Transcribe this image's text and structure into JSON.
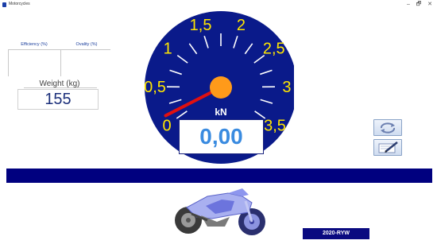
{
  "window": {
    "title": "Motorcycles",
    "minimize": "–",
    "maximize": "🗗",
    "close": "✕"
  },
  "metrics": {
    "efficiency_label": "Efficiency (%)",
    "ovality_label": "Ovality (%)",
    "weight_label": "Weight (kg)",
    "weight_value": "155"
  },
  "gauge": {
    "unit": "kN",
    "display_value": "0,00",
    "tick_labels": [
      "0",
      "0,5",
      "1",
      "1,5",
      "2",
      "2,5",
      "3",
      "3,5"
    ],
    "needle_value": 0,
    "colors": {
      "face": "#0a1a8a",
      "labels": "#ffe600",
      "ticks": "#ffffff",
      "needle": "#e01010",
      "hub": "#ff9a1a"
    }
  },
  "tools": {
    "refresh_icon": "refresh-icon",
    "edit_icon": "edit-icon"
  },
  "vehicle": {
    "plate": "2020-RYW"
  },
  "colors": {
    "banner": "#00007f",
    "plate_bg": "#0a0a80"
  }
}
